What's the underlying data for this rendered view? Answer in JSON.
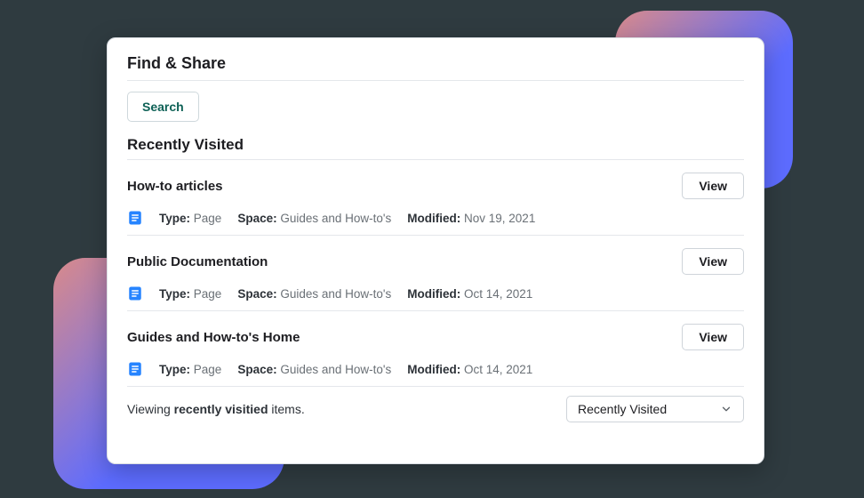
{
  "header": {
    "title": "Find & Share",
    "search_label": "Search"
  },
  "section": {
    "title": "Recently Visited"
  },
  "labels": {
    "type": "Type:",
    "space": "Space:",
    "modified": "Modified:",
    "view": "View"
  },
  "items": [
    {
      "title": "How-to articles",
      "type": "Page",
      "space": "Guides and How-to's",
      "modified": "Nov 19, 2021"
    },
    {
      "title": "Public Documentation",
      "type": "Page",
      "space": "Guides and How-to's",
      "modified": "Oct 14, 2021"
    },
    {
      "title": "Guides and How-to's Home",
      "type": "Page",
      "space": "Guides and How-to's",
      "modified": "Oct 14, 2021"
    }
  ],
  "footer": {
    "prefix": "Viewing ",
    "bold": "recently visitied",
    "suffix": " items.",
    "select_value": "Recently Visited"
  }
}
